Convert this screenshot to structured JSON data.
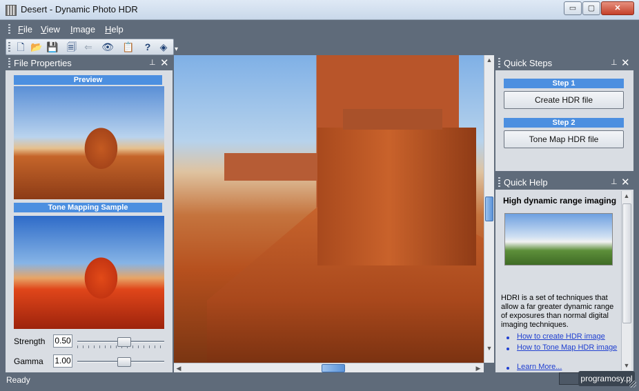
{
  "window": {
    "title": "Desert - Dynamic Photo HDR",
    "min": "▭",
    "max": "▢",
    "close": "✕"
  },
  "menu": {
    "file": "File",
    "view": "View",
    "image": "Image",
    "help": "Help"
  },
  "toolbar": {
    "icons": [
      "new-file-icon",
      "open-folder-icon",
      "save-icon",
      "save-as-icon",
      "back-arrow-icon",
      "view-eye-icon",
      "paste-clipboard-icon",
      "help-question-icon",
      "eraser-icon"
    ],
    "overflow": "▾"
  },
  "file_properties": {
    "title": "File Properties",
    "pin": "📌",
    "close": "✕",
    "preview_label": "Preview",
    "tone_label": "Tone Mapping Sample",
    "strength_label": "Strength",
    "strength_value": "0.50",
    "strength_level": 0.5,
    "gamma_label": "Gamma",
    "gamma_value": "1.00",
    "gamma_level": 0.5
  },
  "quick_steps": {
    "title": "Quick Steps",
    "pin": "📌",
    "close": "✕",
    "step1_label": "Step 1",
    "step1_button": "Create HDR file",
    "step2_label": "Step 2",
    "step2_button": "Tone Map HDR file"
  },
  "quick_help": {
    "title": "Quick Help",
    "pin": "📌",
    "close": "✕",
    "heading": "High dynamic range imaging",
    "body": "HDRI is a set of techniques that allow a far greater dynamic range of exposures than normal digital imaging techniques.",
    "links": [
      "How to create HDR image",
      "How to Tone Map HDR image",
      "Learn More..."
    ]
  },
  "status": {
    "text": "Ready"
  },
  "watermark": "programosy.pl"
}
